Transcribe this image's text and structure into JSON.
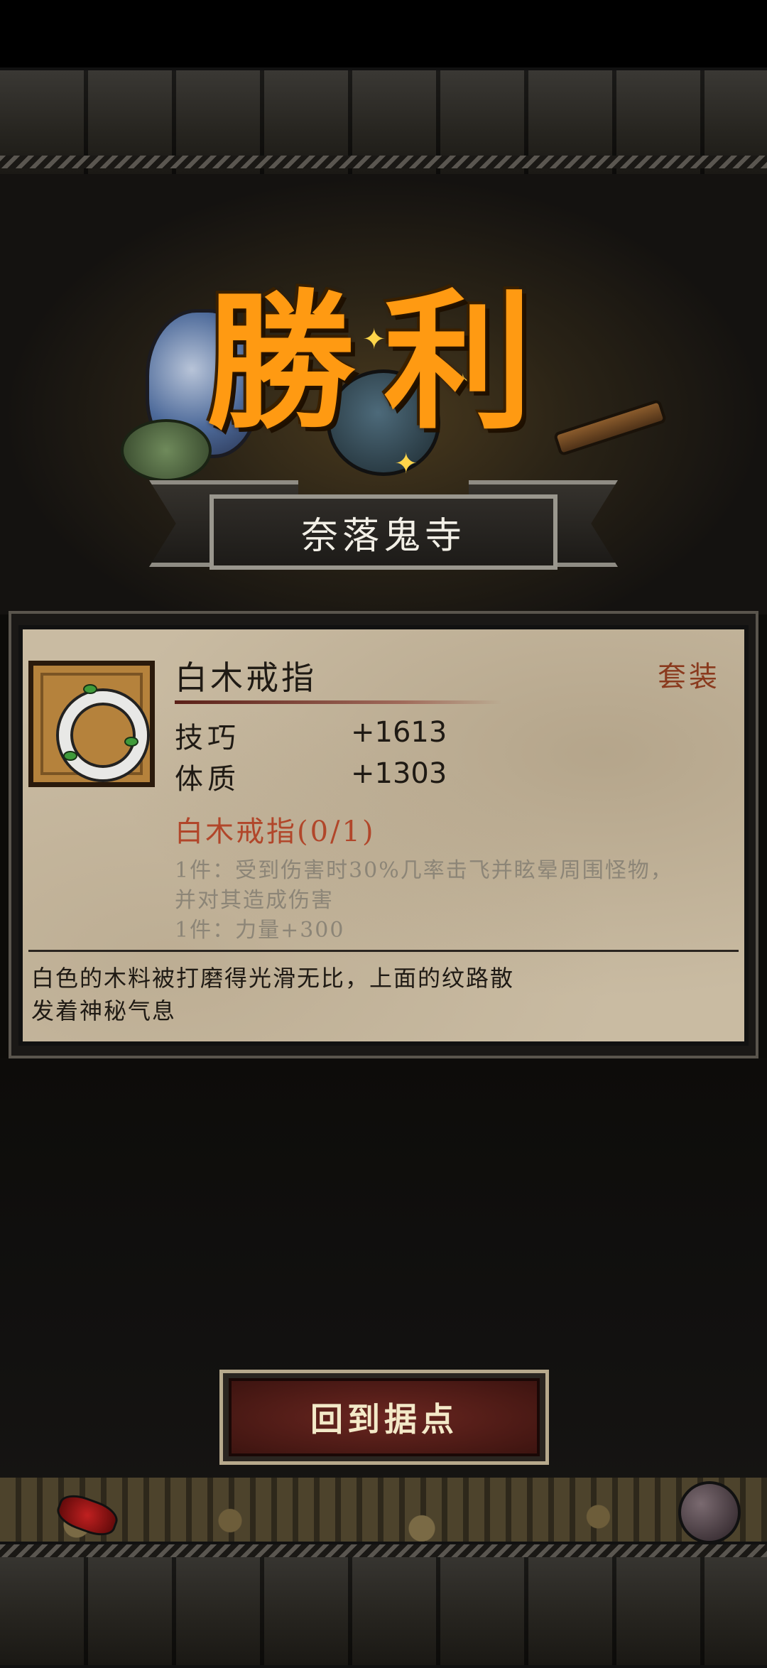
{
  "header": {
    "victory_title": "勝利",
    "stage_name": "奈落鬼寺"
  },
  "item": {
    "name": "白木戒指",
    "tag": "套装",
    "icon": "white-wood-ring",
    "stats": [
      {
        "label": "技巧",
        "value": "+1613"
      },
      {
        "label": "体质",
        "value": "+1303"
      }
    ],
    "set": {
      "name": "白木戒指(0/1)",
      "bonus_lines": [
        "1件：受到伤害时30%几率击飞并眩晕周围怪物，",
        "并对其造成伤害",
        "1件：力量+300"
      ]
    },
    "flavor_lines": [
      "白色的木料被打磨得光滑无比，上面的纹路散",
      "发着神秘气息"
    ]
  },
  "actions": {
    "return_label": "回到据点"
  },
  "colors": {
    "title": "#ff9a12",
    "set_name": "#b1462a",
    "set_tag": "#8a3a1e",
    "button_bg": "#5a1e18",
    "parchment": "#c9bba2"
  }
}
